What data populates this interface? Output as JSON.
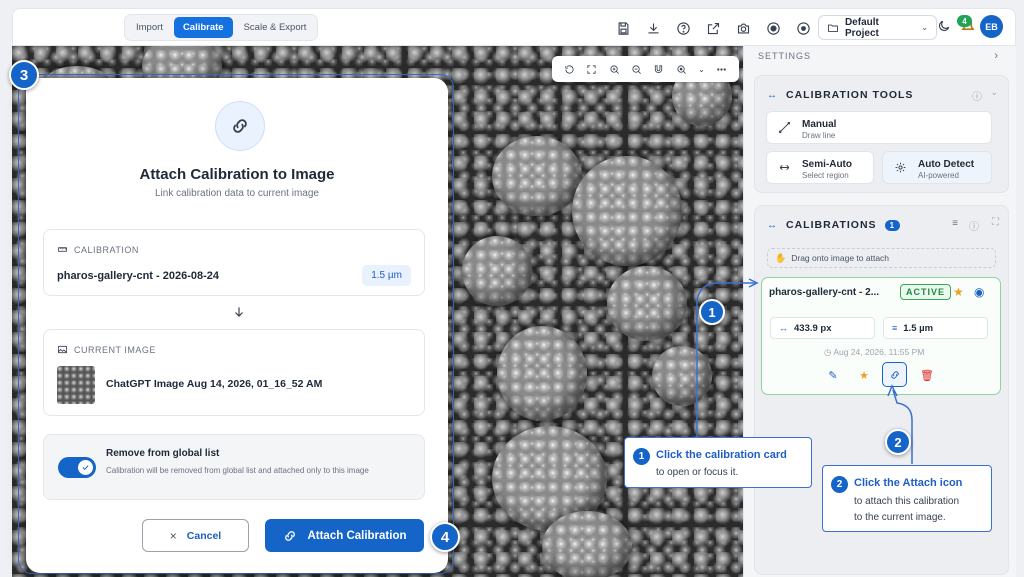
{
  "topbar": {
    "tabs": [
      {
        "label": "Import",
        "active": false
      },
      {
        "label": "Calibrate",
        "active": true
      },
      {
        "label": "Scale & Export",
        "active": false
      }
    ],
    "icons": [
      "save-icon",
      "download-icon",
      "help-icon",
      "external-link-icon",
      "camera-icon",
      "record-icon",
      "target-icon"
    ],
    "project_label": "Default Project",
    "notification_count": "4",
    "avatar_initials": "EB",
    "accent": "#1565c8"
  },
  "image_toolbar": {
    "icons": [
      "rotate-icon",
      "fit-screen-icon",
      "zoom-in-icon",
      "zoom-out-icon",
      "magnet-icon",
      "zoom-level-icon",
      "more-icon"
    ]
  },
  "modal": {
    "title": "Attach Calibration to Image",
    "subtitle": "Link calibration data to current image",
    "calibration_label": "CALIBRATION",
    "calibration_name": "pharos-gallery-cnt - 2026-08-24",
    "calibration_value": "1.5 µm",
    "image_label": "CURRENT IMAGE",
    "image_name": "ChatGPT Image Aug 14, 2026, 01_16_52 AM",
    "toggle_title": "Remove from global list",
    "toggle_desc": "Calibration will be removed from global list and attached only to this image",
    "toggle_on": true,
    "cancel_label": "Cancel",
    "attach_label": "Attach Calibration"
  },
  "steps": {
    "s1": "1",
    "s2": "2",
    "s3": "3",
    "s4": "4"
  },
  "panel": {
    "settings_label": "SETTINGS",
    "tools_title": "CALIBRATION TOOLS",
    "tools": [
      {
        "title": "Manual",
        "sub": "Draw line"
      },
      {
        "title": "Semi-Auto",
        "sub": "Select region"
      },
      {
        "title": "Auto Detect",
        "sub": "AI-powered"
      }
    ],
    "calibrations_title": "CALIBRATIONS",
    "calibrations_count": "1",
    "drag_hint": "Drag onto image to attach",
    "card": {
      "name": "pharos-gallery-cnt - 2...",
      "status": "ACTIVE",
      "pixels": "433.9 px",
      "length": "1.5 µm",
      "date": "Aug 24, 2026, 11:55 PM"
    }
  },
  "callouts": {
    "c1_title": "Click the calibration card",
    "c1_body": "to open or focus it.",
    "c2_title": "Click the Attach icon",
    "c2_body1": "to attach this calibration",
    "c2_body2": "to the current image."
  }
}
